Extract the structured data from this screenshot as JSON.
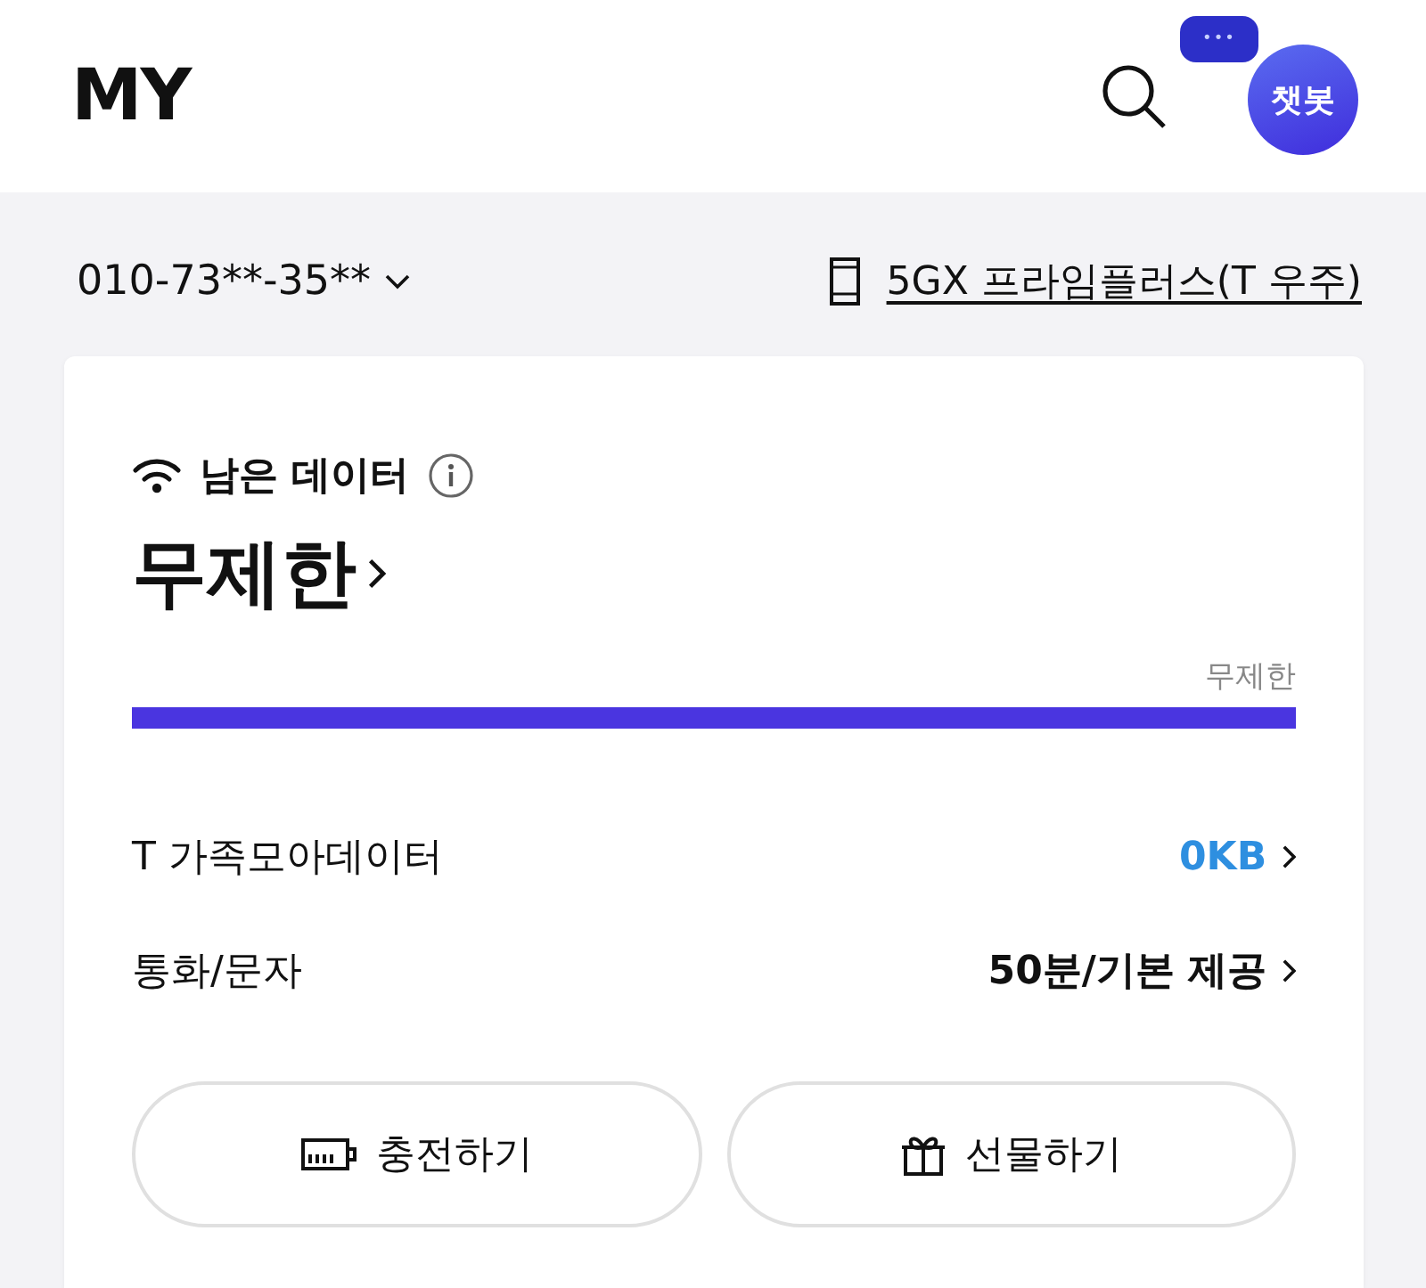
{
  "header": {
    "title": "MY",
    "chatbot_label": "챗봇",
    "chatbot_bubble": "•••"
  },
  "line": {
    "number": "010-73**-35**",
    "plan": "5GX 프라임플러스(T 우주)"
  },
  "data_card": {
    "label": "남은 데이터",
    "amount": "무제한",
    "bar_caption": "무제한",
    "level": 1,
    "rows": [
      {
        "label": "T 가족모아데이터",
        "value": "0KB",
        "highlight": true
      },
      {
        "label": "통화/문자",
        "value": "50분/기본 제공",
        "highlight": false
      }
    ],
    "buttons": [
      {
        "kind": "charge",
        "label": "충전하기"
      },
      {
        "kind": "gift",
        "label": "선물하기"
      }
    ]
  }
}
